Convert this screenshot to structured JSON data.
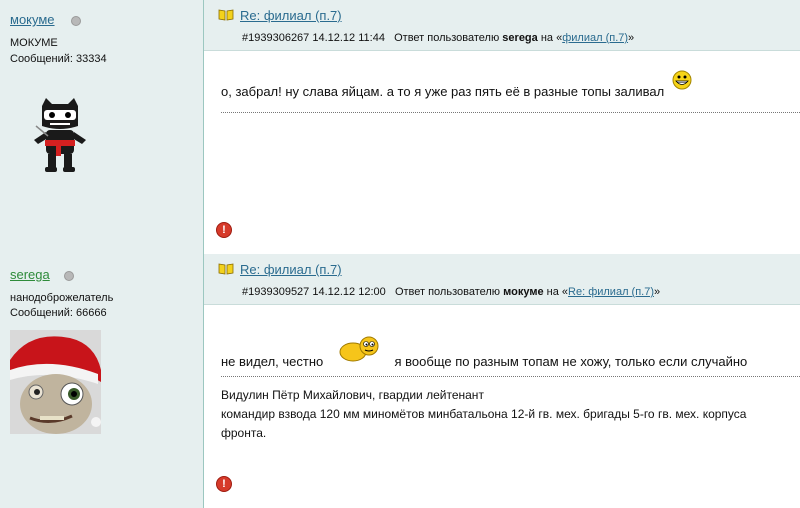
{
  "posts": [
    {
      "author": "мокуме",
      "rank": "МОКУМЕ",
      "count_label": "Сообщений: 33334",
      "title": "Re: филиал (п.7)",
      "id_date": "#1939306267 14.12.12 11:44",
      "reply_prefix": "Ответ пользователю",
      "reply_user": "serega",
      "reply_on": "на «",
      "reply_link": "филиал (п.7)",
      "reply_suffix": "»",
      "text": "о, забрал! ну слава яйцам. а то я уже раз пять её в разные топы заливал",
      "author_color": "#2a6b8f"
    },
    {
      "author": "serega",
      "rank": "нанодоброжелатель",
      "count_label": "Сообщений: 66666",
      "title": "Re: филиал (п.7)",
      "id_date": "#1939309527 14.12.12 12:00",
      "reply_prefix": "Ответ пользователю",
      "reply_user": "мокуме",
      "reply_on": "на «",
      "reply_link": "Re: филиал (п.7)",
      "reply_suffix": "»",
      "text_before": "не видел, честно",
      "text_after": "я вообще по разным топам не хожу, только если случайно",
      "signature": [
        "Видулин Пётр Михайлович, гвардии лейтенант",
        "командир взвода 120 мм миномётов минбатальона 12-й гв. мех. бригады 5-го гв. мех. корпуса",
        "фронта."
      ],
      "author_color": "#2e8b3a"
    }
  ],
  "icons": {
    "book": "book-icon",
    "status": "offline-dot-icon",
    "warning": "warning-icon",
    "smile_grin": "grin-smiley-icon",
    "smile_shy": "shy-smiley-icon"
  }
}
